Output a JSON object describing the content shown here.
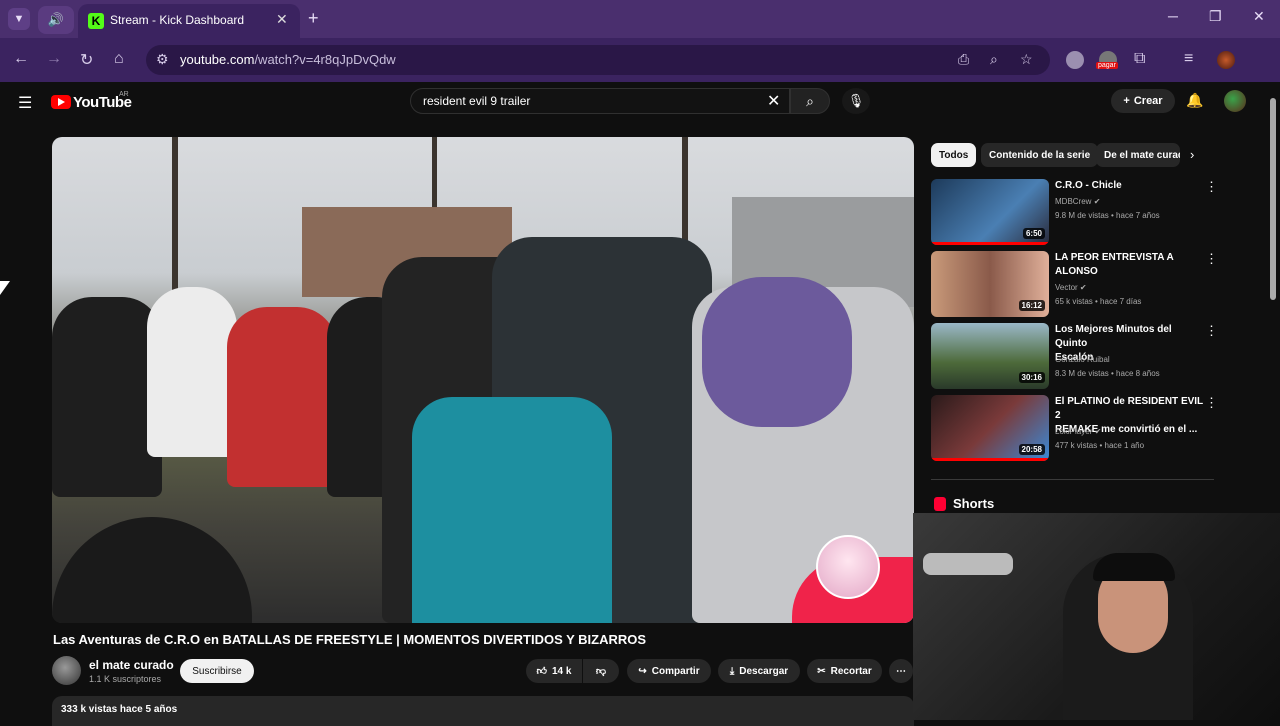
{
  "browser": {
    "tab_inactive_icon": "speaker-icon",
    "active_tab": {
      "title": "Stream - Kick Dashboard",
      "favicon": "K"
    },
    "new_tab": "+",
    "url_host": "youtube.com",
    "url_path": "/watch?v=4r8qJpDvQdw",
    "window_controls": {
      "minimize": "─",
      "maximize": "❐",
      "close": "✕"
    },
    "extension_badge": "pagar"
  },
  "youtube": {
    "logo_text": "YouTube",
    "country": "AR",
    "search_value": "resident evil 9 trailer",
    "create_label": "Crear"
  },
  "video": {
    "title": "Las Aventuras de C.R.O en BATALLAS DE FREESTYLE | MOMENTOS DIVERTIDOS Y BIZARROS",
    "channel": "el mate curado",
    "subscribers": "1.1 K suscriptores",
    "subscribe_label": "Suscribirse",
    "likes": "14 k",
    "share_label": "Compartir",
    "download_label": "Descargar",
    "clip_label": "Recortar",
    "views_date": "333 k vistas  hace 5 años"
  },
  "sidebar": {
    "chips": [
      "Todos",
      "Contenido de la serie",
      "De el mate curado"
    ],
    "recommendations": [
      {
        "title_line1": "C.R.O - Chicle",
        "title_line2": "",
        "channel": "MDBCrew",
        "meta": "9.8 M de vistas • hace 7 años",
        "duration": "6:50"
      },
      {
        "title_line1": "LA PEOR ENTREVISTA A",
        "title_line2": "ALONSO",
        "channel": "Vector",
        "meta": "65 k vistas • hace 7 días",
        "duration": "16:12"
      },
      {
        "title_line1": "Los Mejores Minutos del Quinto",
        "title_line2": "Escalón",
        "channel": "Gonzalo Ruibal",
        "meta": "8.3 M de vistas • hace 8 años",
        "duration": "30:16"
      },
      {
        "title_line1": "El PLATINO de RESIDENT EVIL 2",
        "title_line2": "REMAKE me convirtió en el ...",
        "channel": "LokiPlayer",
        "meta": "477 k vistas • hace 1 año",
        "duration": "20:58"
      }
    ],
    "shorts_label": "Shorts"
  },
  "colors": {
    "yt_red": "#ff0000",
    "browser_purple": "#4a2f6e",
    "kick_green": "#53fc18"
  }
}
